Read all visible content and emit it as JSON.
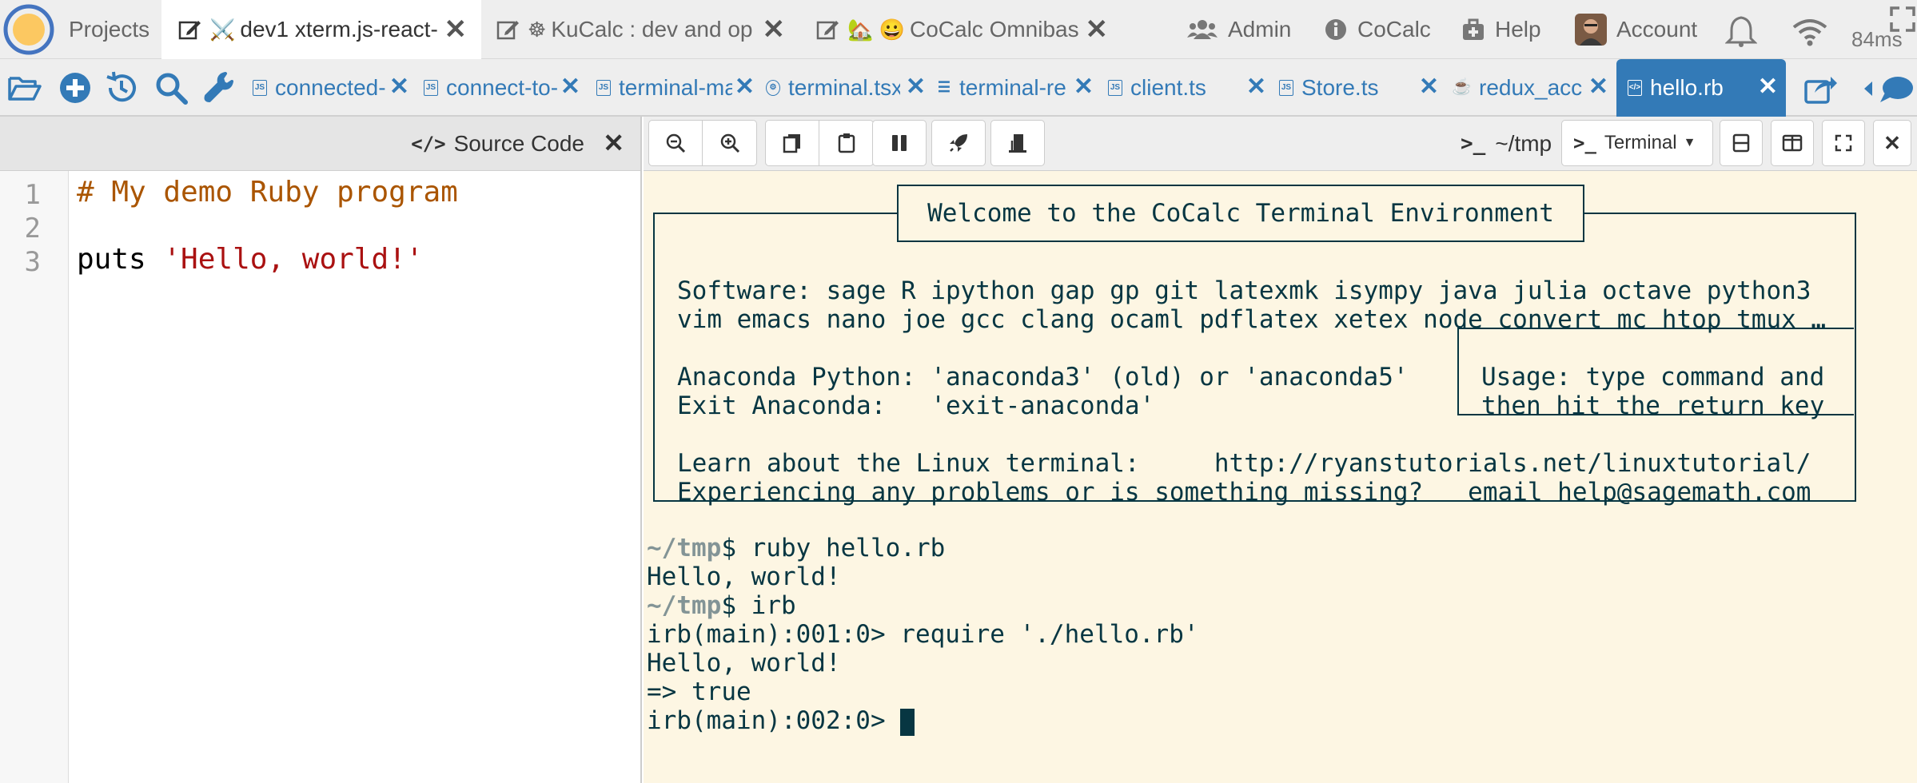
{
  "topbar": {
    "projects_label": "Projects",
    "tabs": [
      {
        "label": "dev1 xterm.js-react-",
        "emoji": "⚔️"
      },
      {
        "label": "KuCalc : dev and op",
        "emoji": "☸"
      },
      {
        "label": "CoCalc Omnibas",
        "emoji": "🏡 😀"
      }
    ],
    "admin_label": "Admin",
    "cocalc_label": "CoCalc",
    "help_label": "Help",
    "account_label": "Account",
    "ping": "84ms"
  },
  "filetabs": [
    {
      "label": "connected-",
      "type": "JS"
    },
    {
      "label": "connect-to-",
      "type": "JS"
    },
    {
      "label": "terminal-ma",
      "type": "JS"
    },
    {
      "label": "terminal.tsx",
      "type": "TS"
    },
    {
      "label": "terminal-re",
      "type": "list"
    },
    {
      "label": "client.ts",
      "type": "JS"
    },
    {
      "label": "Store.ts",
      "type": "JS"
    },
    {
      "label": "redux_acc",
      "type": "cup"
    },
    {
      "label": "hello.rb",
      "type": "code"
    }
  ],
  "editor": {
    "title": "Source Code",
    "line_numbers": [
      "1",
      "2",
      "3"
    ],
    "line1": "# My demo Ruby program",
    "line3_kw": "puts ",
    "line3_str": "'Hello, world!'"
  },
  "terminal_bar": {
    "path": "~/tmp",
    "mode": "Terminal"
  },
  "terminal": {
    "welcome": "Welcome to the CoCalc Terminal Environment",
    "software1": "Software: sage R ipython gap gp git latexmk isympy java julia octave python3",
    "software2": "vim emacs nano joe gcc clang ocaml pdflatex xetex node convert mc htop tmux …",
    "anaconda1": "Anaconda Python: 'anaconda3' (old) or 'anaconda5'",
    "anaconda2": "Exit Anaconda:   'exit-anaconda'",
    "usage1": "Usage: type command and",
    "usage2": "then hit the return key",
    "learn": "Learn about the Linux terminal:     http://ryanstutorials.net/linuxtutorial/",
    "problems": "Experiencing any problems or is something missing?   email help@sagemath.com",
    "prompt_dir": "~/tmp",
    "cmd1": "$ ruby hello.rb",
    "out1": "Hello, world!",
    "cmd2": "$ irb",
    "irb1": "irb(main):001:0> require './hello.rb'",
    "out2": "Hello, world!",
    "out3": "=> true",
    "irb2": "irb(main):002:0> "
  },
  "colors": {
    "accent": "#337ab7",
    "terminal_bg": "#fdf6e3",
    "terminal_fg": "#073642"
  }
}
